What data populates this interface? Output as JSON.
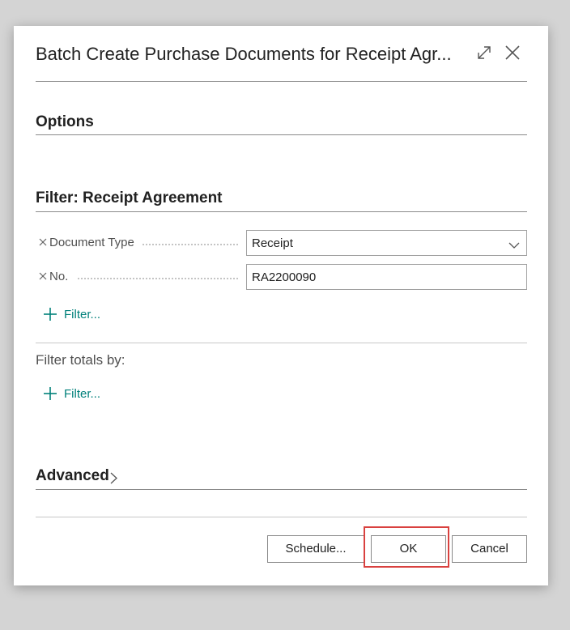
{
  "dialog": {
    "title": "Batch Create Purchase Documents for Receipt Agr...",
    "icons": {
      "expand": "expand-arrows-icon",
      "close": "close-icon"
    }
  },
  "sections": {
    "options": "Options",
    "filter_title": "Filter: Receipt Agreement",
    "filter_totals_label": "Filter totals by:",
    "advanced": "Advanced"
  },
  "filters": [
    {
      "label": "Document Type",
      "value": "Receipt",
      "control": "dropdown"
    },
    {
      "label": "No.",
      "value": "RA2200090",
      "control": "text"
    }
  ],
  "add_filter_label": "Filter...",
  "add_filter_totals_label": "Filter...",
  "buttons": {
    "schedule": "Schedule...",
    "ok": "OK",
    "cancel": "Cancel"
  },
  "colors": {
    "accent_link": "#00807a",
    "highlight_border": "#d9413f",
    "overlay_background": "#d4d4d4"
  }
}
